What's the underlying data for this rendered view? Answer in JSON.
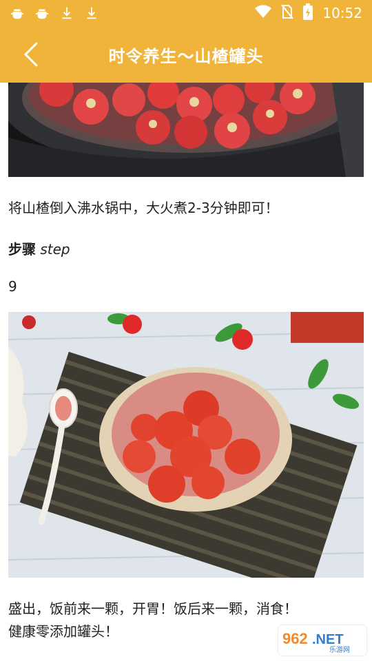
{
  "status": {
    "left_icons": [
      "bug-icon",
      "bug-icon",
      "download-icon",
      "download-icon"
    ],
    "time": "10:52"
  },
  "header": {
    "title": "时令养生～山楂罐头"
  },
  "content": {
    "instruction_1": "将山楂倒入沸水锅中，大火煮2-3分钟即可！",
    "step_label_cn": "步骤",
    "step_label_en": "step",
    "step_number": "9",
    "instruction_2_line1": "盛出，饭前来一颗，开胃！饭后来一颗，消食！",
    "instruction_2_line2": "健康零添加罐头！"
  },
  "watermark": {
    "text": "962.NET",
    "subtext": "乐游网"
  }
}
